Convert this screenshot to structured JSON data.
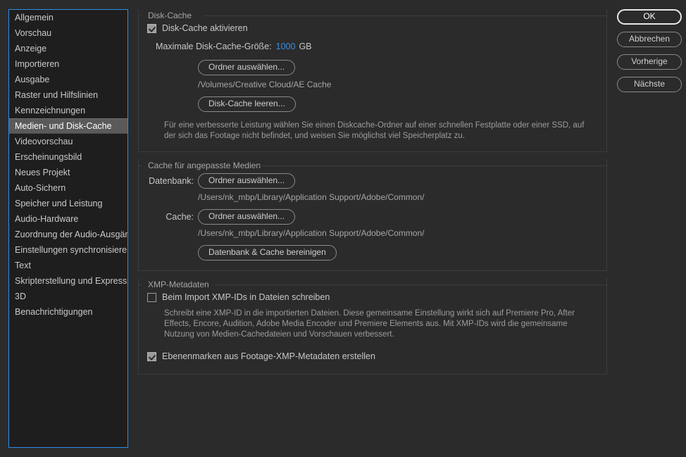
{
  "sidebar": {
    "items": [
      {
        "label": "Allgemein",
        "selected": false
      },
      {
        "label": "Vorschau",
        "selected": false
      },
      {
        "label": "Anzeige",
        "selected": false
      },
      {
        "label": "Importieren",
        "selected": false
      },
      {
        "label": "Ausgabe",
        "selected": false
      },
      {
        "label": "Raster und Hilfslinien",
        "selected": false
      },
      {
        "label": "Kennzeichnungen",
        "selected": false
      },
      {
        "label": "Medien- und Disk-Cache",
        "selected": true
      },
      {
        "label": "Videovorschau",
        "selected": false
      },
      {
        "label": "Erscheinungsbild",
        "selected": false
      },
      {
        "label": "Neues Projekt",
        "selected": false
      },
      {
        "label": "Auto-Sichern",
        "selected": false
      },
      {
        "label": "Speicher und Leistung",
        "selected": false
      },
      {
        "label": "Audio-Hardware",
        "selected": false
      },
      {
        "label": "Zuordnung der Audio-Ausgänge",
        "selected": false
      },
      {
        "label": "Einstellungen synchronisieren",
        "selected": false
      },
      {
        "label": "Text",
        "selected": false
      },
      {
        "label": "Skripterstellung und Expressions",
        "selected": false
      },
      {
        "label": "3D",
        "selected": false
      },
      {
        "label": "Benachrichtigungen",
        "selected": false
      }
    ]
  },
  "disk_cache": {
    "legend": "Disk-Cache",
    "enable_label": "Disk-Cache aktivieren",
    "enable_checked": true,
    "max_size_label": "Maximale Disk-Cache-Größe:",
    "max_size_value": "1000",
    "max_size_unit": "GB",
    "choose_folder_button": "Ordner auswählen...",
    "folder_path": "/Volumes/Creative Cloud/AE Cache",
    "empty_cache_button": "Disk-Cache leeren...",
    "hint": "Für eine verbesserte Leistung wählen Sie einen Diskcache-Ordner auf einer schnellen Festplatte oder einer SSD, auf der sich das Footage nicht befindet, und weisen Sie möglichst viel Speicherplatz zu."
  },
  "conformed_media": {
    "legend": "Cache für angepasste Medien",
    "database_label": "Datenbank:",
    "database_button": "Ordner auswählen...",
    "database_path": "/Users/nk_mbp/Library/Application Support/Adobe/Common/",
    "cache_label": "Cache:",
    "cache_button": "Ordner auswählen...",
    "cache_path": "/Users/nk_mbp/Library/Application Support/Adobe/Common/",
    "clean_button": "Datenbank & Cache bereinigen"
  },
  "xmp": {
    "legend": "XMP-Metadaten",
    "write_ids_label": "Beim Import XMP-IDs in Dateien schreiben",
    "write_ids_checked": false,
    "hint": "Schreibt eine XMP-ID in die importierten Dateien. Diese gemeinsame Einstellung wirkt sich auf Premiere Pro, After Effects, Encore, Audition, Adobe Media Encoder und Premiere Elements aus. Mit XMP-IDs wird die gemeinsame Nutzung von Medien-Cachedateien und Vorschauen verbessert.",
    "layer_markers_label": "Ebenenmarken aus Footage-XMP-Metadaten erstellen",
    "layer_markers_checked": true
  },
  "buttons": {
    "ok": "OK",
    "cancel": "Abbrechen",
    "previous": "Vorherige",
    "next": "Nächste"
  },
  "colors": {
    "accent_blue": "#3a8ee0",
    "focus_border": "#2d8ceb",
    "window_bg": "#2b2b2b",
    "list_bg": "#1e1e1e",
    "selection_bg": "#5a5a5a"
  }
}
